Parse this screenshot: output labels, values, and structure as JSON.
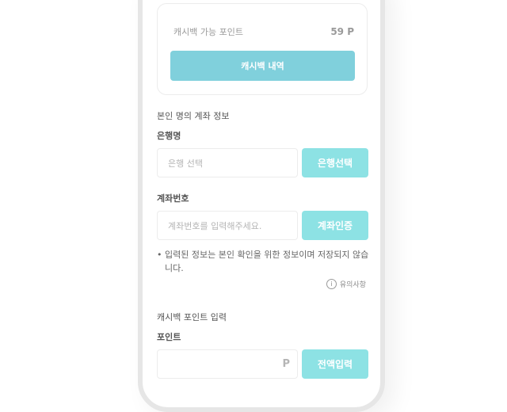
{
  "cashback": {
    "available_label": "캐시백 가능 포인트",
    "available_value": "59 P",
    "history_button": "캐시백 내역"
  },
  "account": {
    "section_title": "본인 명의 계좌 정보",
    "bank_label": "은행명",
    "bank_placeholder": "은행 선택",
    "bank_button": "은행선택",
    "number_label": "계좌번호",
    "number_placeholder": "계좌번호를 입력해주세요.",
    "verify_button": "계좌인증",
    "notice_bullet": "•",
    "notice": "입력된 정보는 본인 확인을 위한 정보이며 저장되지 않습니다.",
    "caution_icon": "i",
    "caution_link": "유의사항"
  },
  "points": {
    "section_title": "캐시백 포인트 입력",
    "label": "포인트",
    "unit": "P",
    "full_button": "전액입력"
  },
  "colors": {
    "primary_button": "#80d0dc",
    "accent_button": "#8de2e4"
  }
}
